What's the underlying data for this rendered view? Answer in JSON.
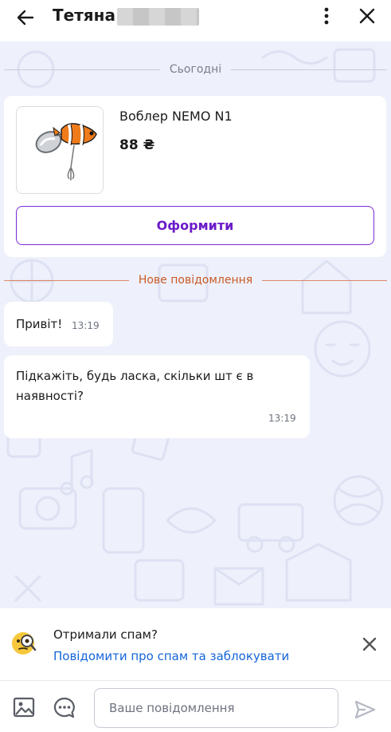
{
  "header": {
    "contact_name": "Тетяна",
    "back_icon": "arrow-left-icon",
    "more_icon": "more-vertical-icon",
    "close_icon": "close-icon"
  },
  "chat": {
    "date_divider": "Сьогодні",
    "product": {
      "title": "Воблер NEMO N1",
      "price": "88 ₴",
      "order_button": "Оформити"
    },
    "new_divider": "Нове повідомлення",
    "messages": [
      {
        "text": "Привіт!",
        "time": "13:19"
      },
      {
        "text": "Підкажіть, будь ласка, скільки шт є в наявності?",
        "time": "13:19"
      }
    ]
  },
  "spam": {
    "question": "Отримали спам?",
    "link": "Повідомити про спам та заблокувати",
    "icon": "magnifier-emoji-icon"
  },
  "composer": {
    "placeholder": "Ваше повідомлення",
    "photo_icon": "image-icon",
    "quick_reply_icon": "chat-bubble-icon",
    "send_icon": "send-icon"
  },
  "colors": {
    "accent": "#6a1bc9",
    "link": "#1565d8",
    "new_divider": "#c85a25",
    "chat_background": "#eef0fb"
  }
}
